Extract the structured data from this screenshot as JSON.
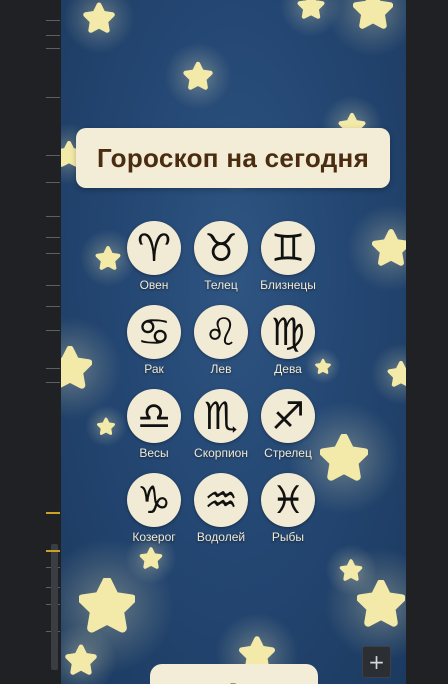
{
  "title": "Гороскоп на сегодня",
  "signs": [
    {
      "glyph": "♈",
      "label": "Овен"
    },
    {
      "glyph": "♉",
      "label": "Телец"
    },
    {
      "glyph": "♊",
      "label": "Близнецы"
    },
    {
      "glyph": "♋",
      "label": "Рак"
    },
    {
      "glyph": "♌",
      "label": "Лев"
    },
    {
      "glyph": "♍",
      "label": "Дева"
    },
    {
      "glyph": "♎",
      "label": "Весы"
    },
    {
      "glyph": "♏",
      "label": "Скорпион"
    },
    {
      "glyph": "♐",
      "label": "Стрелец"
    },
    {
      "glyph": "♑",
      "label": "Козерог"
    },
    {
      "glyph": "♒",
      "label": "Водолей"
    },
    {
      "glyph": "♓",
      "label": "Рыбы"
    }
  ],
  "bottom_button_label": "В",
  "add_button_label": "+",
  "colors": {
    "card": "#f3ecd6",
    "title_text": "#4a2c10",
    "background": "#244773",
    "star": "#f3e9a8",
    "accent_tick": "#c9a227"
  }
}
